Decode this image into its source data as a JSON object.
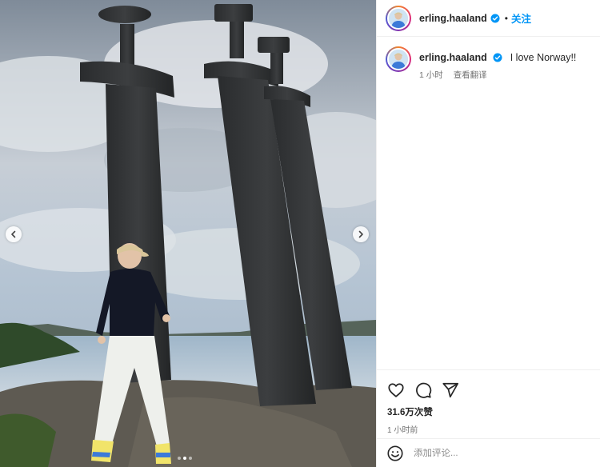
{
  "post": {
    "username": "erling.haaland",
    "follow_label": "关注",
    "separator": "•",
    "caption_text": "I love Norway!!",
    "caption_age": "1 小时",
    "translate_label": "查看翻译",
    "likes": "31.6万次赞",
    "timestamp": "1 小时前",
    "comment_placeholder": "添加评论..."
  },
  "media": {
    "image_description": "Man posing in front of three giant sword sculptures on rocky shore by a fjord",
    "carousel_total": 3,
    "carousel_active": 1
  },
  "icons": {
    "verified": "verified-badge-icon",
    "like": "heart-icon",
    "comment": "comment-bubble-icon",
    "share": "paper-plane-icon",
    "emoji": "smiley-icon",
    "prev": "chevron-left-icon",
    "next": "chevron-right-icon"
  },
  "colors": {
    "accent": "#0095f6",
    "verified": "#0095f6",
    "secondary_text": "#737373"
  }
}
